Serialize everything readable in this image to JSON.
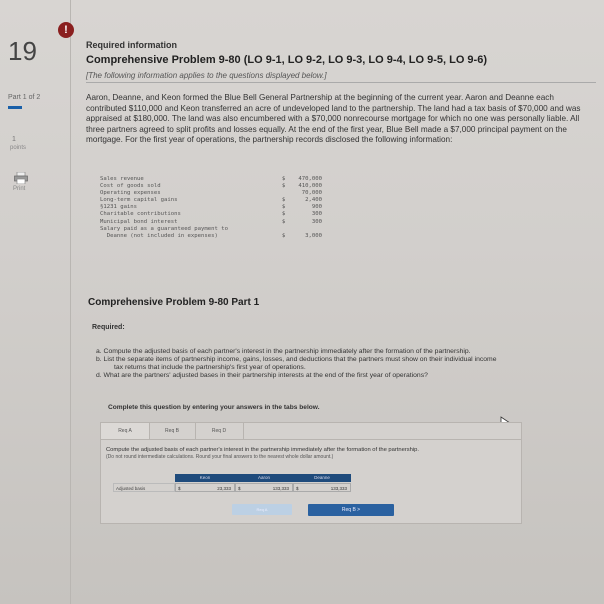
{
  "sidebar": {
    "question_number": "19",
    "alert_symbol": "!",
    "part_label": "Part 1 of 2",
    "points_value": "1",
    "points_label": "points",
    "print_label": "Print"
  },
  "header": {
    "required_information": "Required information",
    "title": "Comprehensive Problem 9-80 (LO 9-1, LO 9-2, LO 9-3, LO 9-4, LO 9-5, LO 9-6)",
    "subtitle": "[The following information applies to the questions displayed below.]"
  },
  "paragraph": "Aaron, Deanne, and Keon formed the Blue Bell General Partnership at the beginning of the current year. Aaron and Deanne each contributed $110,000 and Keon transferred an acre of undeveloped land to the partnership. The land had a tax basis of $70,000 and was appraised at $180,000. The land was also encumbered with a $70,000 nonrecourse mortgage for which no one was personally liable. All three partners agreed to split profits and losses equally. At the end of the first year, Blue Bell made a $7,000 principal payment on the mortgage. For the first year of operations, the partnership records disclosed the following information:",
  "financials": [
    {
      "label": "Sales revenue",
      "currency": "$",
      "value": "470,000"
    },
    {
      "label": "Cost of goods sold",
      "currency": "$",
      "value": "410,000"
    },
    {
      "label": "Operating expenses",
      "currency": "",
      "value": "70,000"
    },
    {
      "label": "Long-term capital gains",
      "currency": "$",
      "value": "2,400"
    },
    {
      "label": "§1231 gains",
      "currency": "$",
      "value": "900"
    },
    {
      "label": "Charitable contributions",
      "currency": "$",
      "value": "300"
    },
    {
      "label": "Municipal bond interest",
      "currency": "$",
      "value": "300"
    },
    {
      "label": "Salary paid as a guaranteed payment to",
      "currency": "",
      "value": ""
    },
    {
      "label": "  Deanne (not included in expenses)",
      "currency": "$",
      "value": "3,000"
    }
  ],
  "part1": {
    "title": "Comprehensive Problem 9-80 Part 1",
    "required_label": "Required:",
    "requirements": [
      "a. Compute the adjusted basis of each partner's interest in the partnership immediately after the formation of the partnership.",
      "b. List the separate items of partnership income, gains, losses, and deductions that the partners must show on their individual income",
      "tax returns that include the partnership's first year of operations.",
      "d. What are the partners' adjusted bases in their partnership interests at the end of the first year of operations?"
    ],
    "complete_instruction": "Complete this question by entering your answers in the tabs below."
  },
  "tabs": [
    {
      "label": "Req A"
    },
    {
      "label": "Req B"
    },
    {
      "label": "Req D"
    }
  ],
  "tab_content": {
    "instruction": "Compute the adjusted basis of each partner's interest in the partnership immediately after the formation of the partnership.",
    "sub_instruction": "(Do not round intermediate calculations. Round your final answers to the nearest whole dollar amount.)",
    "columns": [
      "Keon",
      "Aaron",
      "Deanne"
    ],
    "row_label": "Adjusted basis",
    "values": [
      {
        "currency": "$",
        "value": "23,333"
      },
      {
        "currency": "$",
        "value": "133,333"
      },
      {
        "currency": "$",
        "value": "133,333"
      }
    ]
  },
  "nav": {
    "prev_label": "Req A",
    "next_label": "Req B  >"
  },
  "colors": {
    "accent": "#1f4b7c",
    "alert": "#8a1f1f",
    "next_button": "#2a61a0"
  }
}
